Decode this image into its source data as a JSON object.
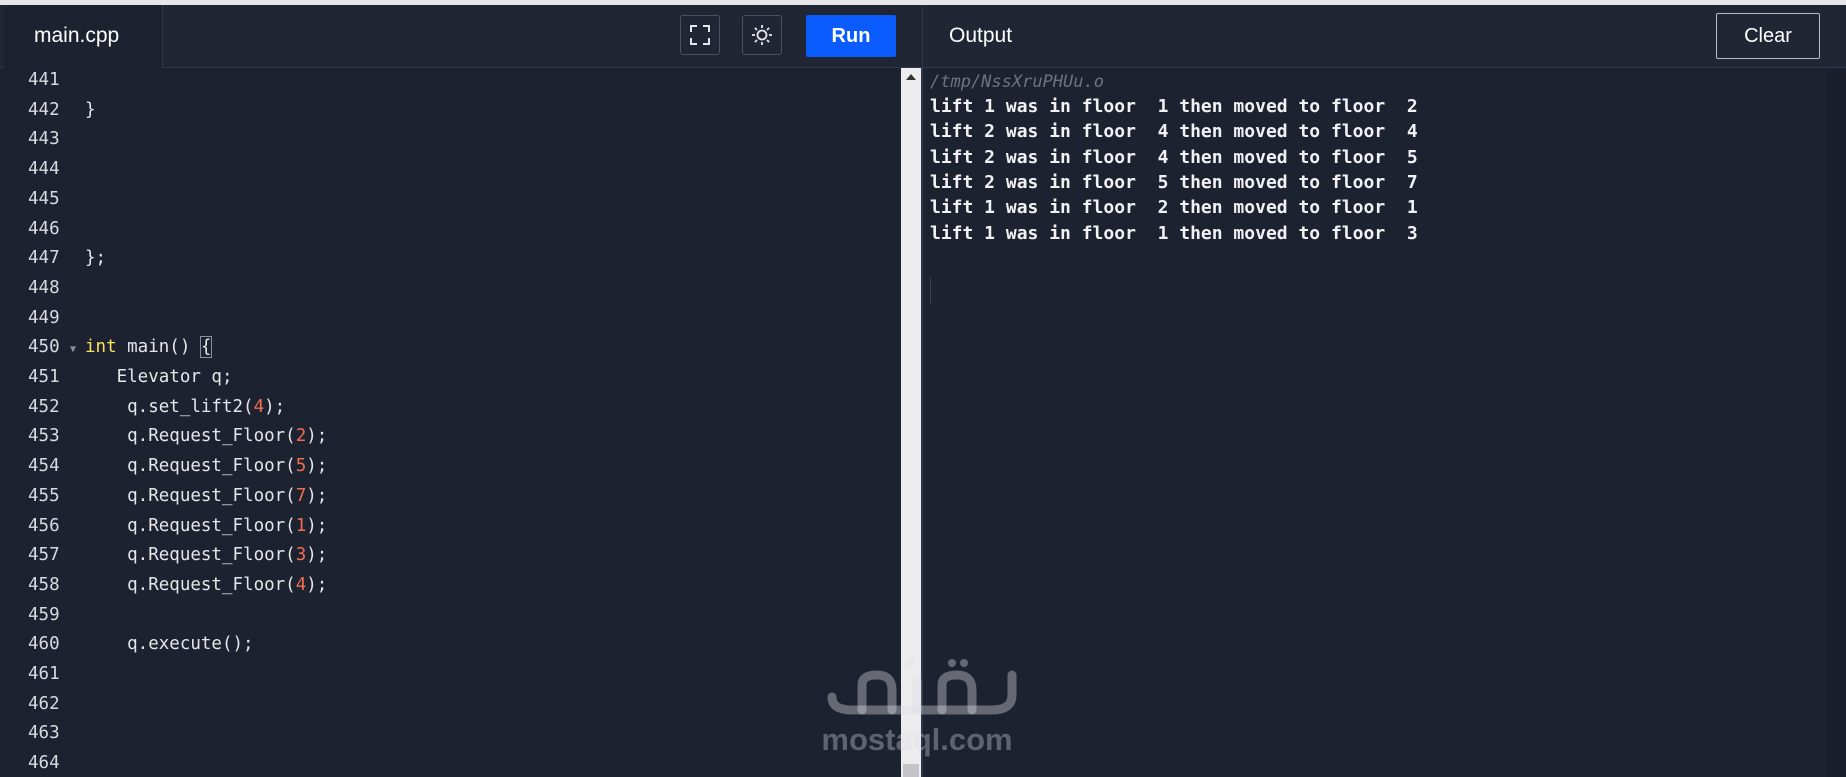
{
  "editor_tab": {
    "label": "main.cpp"
  },
  "toolbar": {
    "fullscreen_icon": "fullscreen-icon",
    "theme_icon": "sun-icon",
    "run_label": "Run"
  },
  "output_panel": {
    "title": "Output",
    "clear_label": "Clear",
    "path": "/tmp/NssXruPHUu.o",
    "lines": [
      "lift 1 was in floor  1 then moved to floor  2",
      "lift 2 was in floor  4 then moved to floor  4",
      "lift 2 was in floor  4 then moved to floor  5",
      "lift 2 was in floor  5 then moved to floor  7",
      "lift 1 was in floor  2 then moved to floor  1",
      "lift 1 was in floor  1 then moved to floor  3"
    ]
  },
  "code": {
    "line_numbers": [
      "441",
      "442",
      "443",
      "444",
      "445",
      "446",
      "447",
      "448",
      "449",
      "450",
      "451",
      "452",
      "453",
      "454",
      "455",
      "456",
      "457",
      "458",
      "459",
      "460",
      "461",
      "462",
      "463",
      "464"
    ],
    "l442": "}",
    "l447": "};",
    "l450_kw": "int",
    "l450_rest": " main() ",
    "l450_brace": "{",
    "l451": "   Elevator q;",
    "l452_a": "    q.set_lift2(",
    "l452_n": "4",
    "l452_b": ");",
    "l453_a": "    q.Request_Floor(",
    "l453_n": "2",
    "l453_b": ");",
    "l454_a": "    q.Request_Floor(",
    "l454_n": "5",
    "l454_b": ");",
    "l455_a": "    q.Request_Floor(",
    "l455_n": "7",
    "l455_b": ");",
    "l456_a": "    q.Request_Floor(",
    "l456_n": "1",
    "l456_b": ");",
    "l457_a": "    q.Request_Floor(",
    "l457_n": "3",
    "l457_b": ");",
    "l458_a": "    q.Request_Floor(",
    "l458_n": "4",
    "l458_b": ");",
    "l460": "    q.execute();"
  },
  "watermark": {
    "text": "mostaql.com"
  },
  "colors": {
    "background": "#1d2230",
    "run_button": "#0b5cff",
    "keyword": "#f8e45c",
    "number": "#f26d50"
  }
}
